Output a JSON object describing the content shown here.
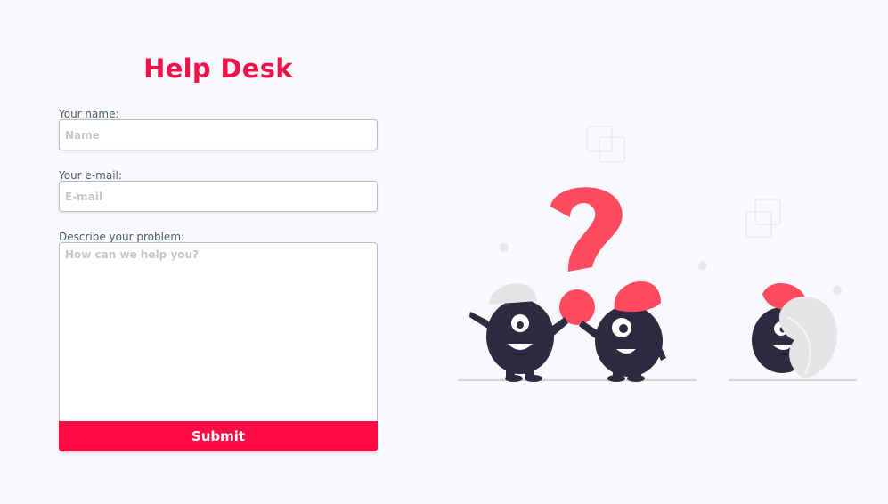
{
  "app": {
    "title": "Help Desk"
  },
  "form": {
    "name_label": "Your name:",
    "name_placeholder": "Name",
    "name_value": "",
    "email_label": "Your e-mail:",
    "email_placeholder": "E-mail",
    "email_value": "",
    "problem_label": "Describe your problem:",
    "problem_placeholder": "How can we help you?",
    "problem_value": "",
    "submit_label": "Submit"
  },
  "illustration": {
    "icon": "help-characters-illustration",
    "accent_color": "#ff4a5f",
    "character_color": "#2f2a40"
  },
  "colors": {
    "brand": "#f0124a",
    "button": "#ff0a45",
    "background": "#f8f9fc"
  }
}
